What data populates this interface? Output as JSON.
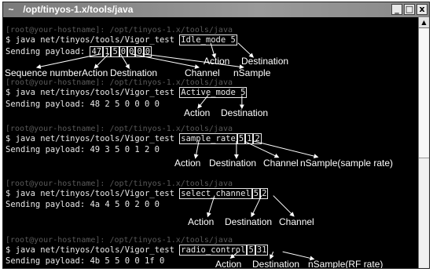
{
  "window": {
    "title": "/opt/tinyos-1.x/tools/java",
    "system_icon": "terminal-icon",
    "minimize_label": "_",
    "maximize_label": "□",
    "close_label": "x"
  },
  "blocks": [
    {
      "prompt": "[root@your-hostname]: /opt/tinyos-1.x/tools/java",
      "cmd_prefix": "$ java net/tinyos/tools/Vigor_test ",
      "args": [
        "Idle_mode",
        "5"
      ],
      "payload_prefix": "Sending payload: ",
      "payload_values": [
        "47",
        "1",
        "5",
        "0",
        "0",
        "0",
        "0"
      ],
      "payload_boxed": true,
      "annotations": [
        "Action",
        "Destination",
        "Sequence number",
        "Action",
        "Destination",
        "Channel",
        "nSample"
      ]
    },
    {
      "prompt": "[root@your-hostname]: /opt/tinyos-1.x/tools/java",
      "cmd_prefix": "$ java net/tinyos/tools/Vigor_test ",
      "args": [
        "Active_mode",
        "5"
      ],
      "payload_prefix": "Sending payload: ",
      "payload_text": "48 2 5 0 0 0 0",
      "annotations": [
        "Action",
        "Destination"
      ]
    },
    {
      "prompt": "[root@your-hostname]: /opt/tinyos-1.x/tools/java",
      "cmd_prefix": "$ java net/tinyos/tools/Vigor_test ",
      "args": [
        "sample_rate",
        "5",
        "1",
        "2"
      ],
      "payload_prefix": "Sending payload: ",
      "payload_text": "49 3 5 0 1 2 0",
      "annotations": [
        "Action",
        "Destination",
        "Channel",
        "nSample(sample rate)"
      ]
    },
    {
      "prompt": "[root@your-hostname]: /opt/tinyos-1.x/tools/java",
      "cmd_prefix": "$ java net/tinyos/tools/Vigor_test ",
      "args": [
        "select_channel",
        "5",
        "2"
      ],
      "payload_prefix": "Sending payload: ",
      "payload_text": "4a 4 5 0 2 0 0",
      "annotations": [
        "Action",
        "Destination",
        "Channel"
      ]
    },
    {
      "prompt": "[root@your-hostname]: /opt/tinyos-1.x/tools/java",
      "cmd_prefix": "$ java net/tinyos/tools/Vigor_test ",
      "args": [
        "radio_control",
        "5",
        "31"
      ],
      "payload_prefix": "Sending payload: ",
      "payload_text": "4b 5 5 0 0 1f 0",
      "annotations": [
        "Action",
        "Destination",
        "nSample(RF rate)"
      ]
    }
  ]
}
